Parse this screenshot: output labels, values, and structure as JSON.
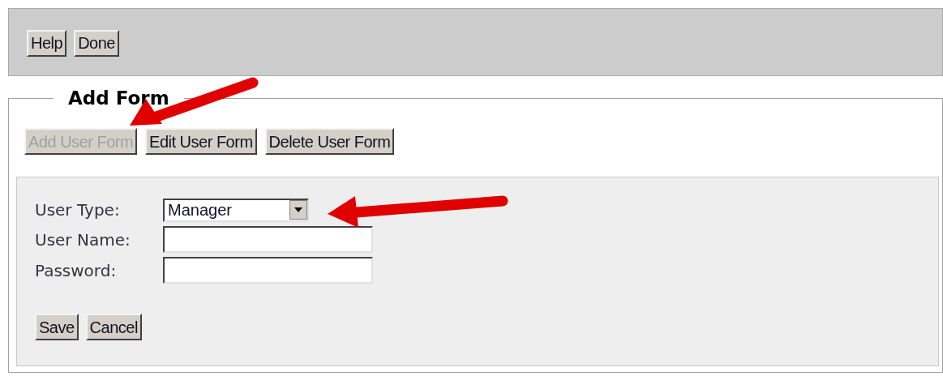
{
  "toolbar": {
    "buttons": [
      {
        "label": "Help",
        "disabled": false
      },
      {
        "label": "Done",
        "disabled": false
      }
    ]
  },
  "add_form": {
    "legend": "Add Form",
    "mode_buttons": [
      {
        "label": "Add User Form",
        "disabled": true
      },
      {
        "label": "Edit User Form",
        "disabled": false
      },
      {
        "label": "Delete User Form",
        "disabled": false
      }
    ],
    "fields": [
      {
        "kind": "select",
        "label": "User Type:",
        "value": "Manager"
      },
      {
        "kind": "text",
        "label": "User Name:"
      },
      {
        "kind": "text",
        "label": "Password:"
      }
    ],
    "buttons": [
      {
        "label": "Save",
        "disabled": false
      },
      {
        "label": "Cancel",
        "disabled": false
      }
    ]
  }
}
